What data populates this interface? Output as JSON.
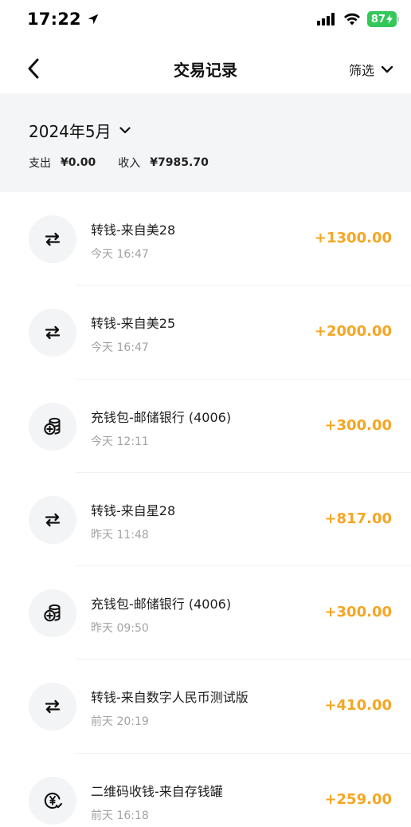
{
  "status_bar": {
    "time": "17:22",
    "battery": "87"
  },
  "nav": {
    "title": "交易记录",
    "filter_label": "筛选"
  },
  "summary": {
    "month": "2024年5月",
    "expense_label": "支出",
    "expense_value": "¥0.00",
    "income_label": "收入",
    "income_value": "¥7985.70"
  },
  "colors": {
    "amount": "#f5a623",
    "summary_bg": "#f4f5f7",
    "icon_bg": "#f3f4f6"
  },
  "transactions": [
    {
      "icon": "transfer-icon",
      "title": "转钱-来自美28",
      "time": "今天 16:47",
      "amount": "+1300.00"
    },
    {
      "icon": "transfer-icon",
      "title": "转钱-来自美25",
      "time": "今天 16:47",
      "amount": "+2000.00"
    },
    {
      "icon": "coin-stack-plus-icon",
      "title": "充钱包-邮储银行 (4006)",
      "time": "今天 12:11",
      "amount": "+300.00"
    },
    {
      "icon": "transfer-icon",
      "title": "转钱-来自星28",
      "time": "昨天 11:48",
      "amount": "+817.00"
    },
    {
      "icon": "coin-stack-plus-icon",
      "title": "充钱包-邮储银行 (4006)",
      "time": "昨天 09:50",
      "amount": "+300.00"
    },
    {
      "icon": "transfer-icon",
      "title": "转钱-来自数字人民币测试版",
      "time": "前天 20:19",
      "amount": "+410.00"
    },
    {
      "icon": "yuan-received-icon",
      "title": "二维码收钱-来自存钱罐",
      "time": "前天 16:18",
      "amount": "+259.00"
    }
  ]
}
